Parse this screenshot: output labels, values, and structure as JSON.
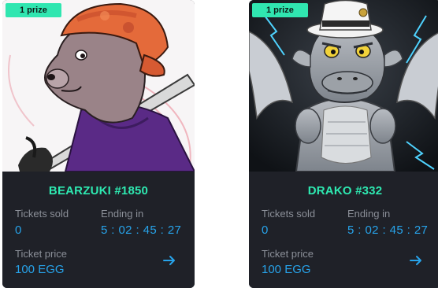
{
  "cards": [
    {
      "badge": "1 prize",
      "name": "BEARZUKI #1850",
      "tickets_sold_label": "Tickets sold",
      "tickets_sold": "0",
      "ending_label": "Ending in",
      "countdown": "5 : 02 : 45 : 27",
      "price_label": "Ticket price",
      "price": "100 EGG",
      "image": "bear-character-art",
      "action_icon": "arrow-right-icon"
    },
    {
      "badge": "1 prize",
      "name": "DRAKO #332",
      "tickets_sold_label": "Tickets sold",
      "tickets_sold": "0",
      "ending_label": "Ending in",
      "countdown": "5 : 02 : 45 : 27",
      "price_label": "Ticket price",
      "price": "100 EGG",
      "image": "dragon-character-art",
      "action_icon": "arrow-right-icon"
    }
  ],
  "colors": {
    "card_bg": "#1f2128",
    "accent_green": "#2ee9b1",
    "value_blue": "#27a3ea",
    "label_gray": "#8b8f98"
  }
}
